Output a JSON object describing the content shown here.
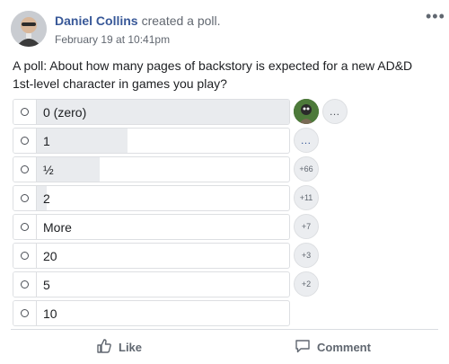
{
  "post": {
    "author": "Daniel Collins",
    "action_text": "created a poll.",
    "timestamp": "February 19 at 10:41pm",
    "more_label": "•••",
    "question": "A poll: About how many pages of backstory is expected for a new AD&D 1st-level character in games you play?"
  },
  "poll": {
    "options": [
      {
        "label": "0 (zero)",
        "vote_share": 1.0
      },
      {
        "label": "1",
        "vote_share": 0.36
      },
      {
        "label": "½",
        "vote_share": 0.25
      },
      {
        "label": "2",
        "vote_share": 0.04
      },
      {
        "label": "More",
        "vote_share": 0.0
      },
      {
        "label": "20",
        "vote_share": 0.0
      },
      {
        "label": "5",
        "vote_share": 0.0
      },
      {
        "label": "10",
        "vote_share": 0.0
      }
    ],
    "voter_bubbles": [
      "…",
      "…",
      "+66",
      "+11",
      "+7",
      "+3",
      "+2"
    ]
  },
  "actions": {
    "like_label": "Like",
    "comment_label": "Comment"
  },
  "colors": {
    "author": "#385898",
    "bar_fill": "#e9ebee",
    "border": "#dddfe2",
    "muted_text": "#606770"
  }
}
